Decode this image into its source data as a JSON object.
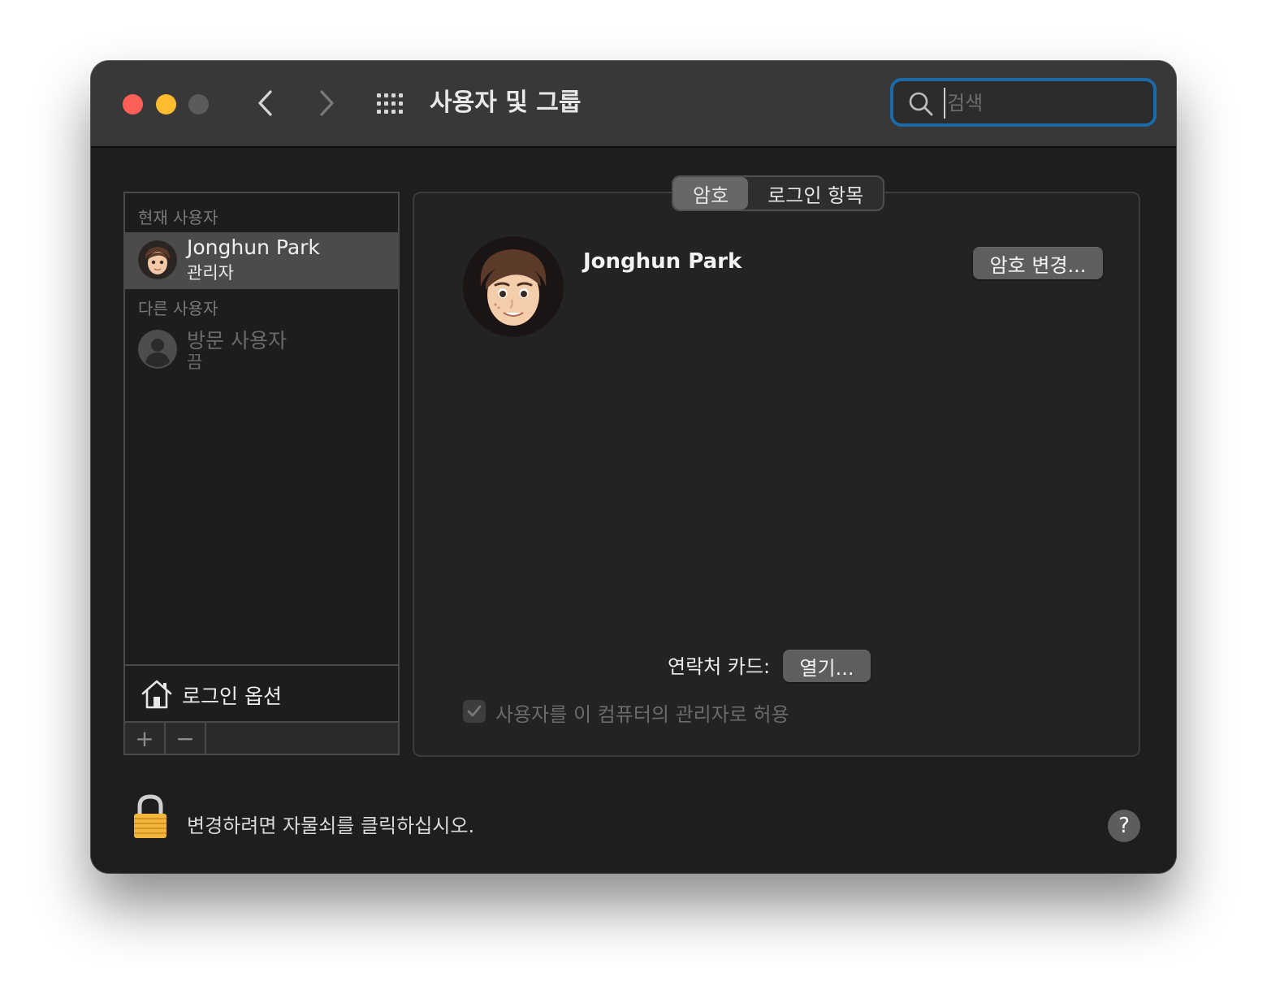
{
  "titlebar": {
    "title": "사용자 및 그룹",
    "back_icon": "chevron-left-icon",
    "forward_icon": "chevron-right-icon",
    "grid_icon": "show-all-grid-icon"
  },
  "search": {
    "placeholder": "검색",
    "value": ""
  },
  "sidebar": {
    "current_header": "현재 사용자",
    "current_user": {
      "name": "Jonghun Park",
      "role": "관리자"
    },
    "other_header": "다른 사용자",
    "guest_user": {
      "name": "방문 사용자",
      "status": "끔"
    },
    "login_options": "로그인 옵션",
    "add_label": "+",
    "remove_label": "−"
  },
  "tabs": [
    {
      "label": "암호",
      "active": true
    },
    {
      "label": "로그인 항목",
      "active": false
    }
  ],
  "main": {
    "user_name": "Jonghun Park",
    "change_password": "암호 변경...",
    "contact_label": "연락처 카드:",
    "open_button": "열기...",
    "admin_checkbox_label": "사용자를 이 컴퓨터의 관리자로 허용",
    "admin_checked": true
  },
  "footer": {
    "lock_text": "변경하려면 자물쇠를 클릭하십시오.",
    "help": "?"
  },
  "colors": {
    "window_bg": "#1e1e1e",
    "titlebar_bg": "#383838",
    "search_focus": "#1c6aa8",
    "close": "#fe5f57",
    "minimize": "#febc2e",
    "zoom_disabled": "#5b5b5b",
    "selection": "#4b4b4b"
  }
}
